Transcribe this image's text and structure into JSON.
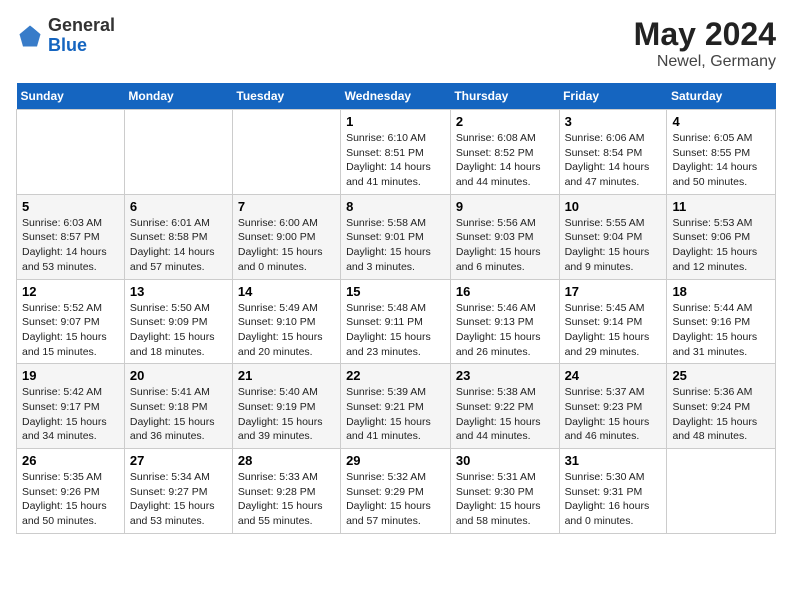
{
  "header": {
    "logo_general": "General",
    "logo_blue": "Blue",
    "month": "May 2024",
    "location": "Newel, Germany"
  },
  "weekdays": [
    "Sunday",
    "Monday",
    "Tuesday",
    "Wednesday",
    "Thursday",
    "Friday",
    "Saturday"
  ],
  "weeks": [
    [
      {
        "day": "",
        "info": ""
      },
      {
        "day": "",
        "info": ""
      },
      {
        "day": "",
        "info": ""
      },
      {
        "day": "1",
        "info": "Sunrise: 6:10 AM\nSunset: 8:51 PM\nDaylight: 14 hours\nand 41 minutes."
      },
      {
        "day": "2",
        "info": "Sunrise: 6:08 AM\nSunset: 8:52 PM\nDaylight: 14 hours\nand 44 minutes."
      },
      {
        "day": "3",
        "info": "Sunrise: 6:06 AM\nSunset: 8:54 PM\nDaylight: 14 hours\nand 47 minutes."
      },
      {
        "day": "4",
        "info": "Sunrise: 6:05 AM\nSunset: 8:55 PM\nDaylight: 14 hours\nand 50 minutes."
      }
    ],
    [
      {
        "day": "5",
        "info": "Sunrise: 6:03 AM\nSunset: 8:57 PM\nDaylight: 14 hours\nand 53 minutes."
      },
      {
        "day": "6",
        "info": "Sunrise: 6:01 AM\nSunset: 8:58 PM\nDaylight: 14 hours\nand 57 minutes."
      },
      {
        "day": "7",
        "info": "Sunrise: 6:00 AM\nSunset: 9:00 PM\nDaylight: 15 hours\nand 0 minutes."
      },
      {
        "day": "8",
        "info": "Sunrise: 5:58 AM\nSunset: 9:01 PM\nDaylight: 15 hours\nand 3 minutes."
      },
      {
        "day": "9",
        "info": "Sunrise: 5:56 AM\nSunset: 9:03 PM\nDaylight: 15 hours\nand 6 minutes."
      },
      {
        "day": "10",
        "info": "Sunrise: 5:55 AM\nSunset: 9:04 PM\nDaylight: 15 hours\nand 9 minutes."
      },
      {
        "day": "11",
        "info": "Sunrise: 5:53 AM\nSunset: 9:06 PM\nDaylight: 15 hours\nand 12 minutes."
      }
    ],
    [
      {
        "day": "12",
        "info": "Sunrise: 5:52 AM\nSunset: 9:07 PM\nDaylight: 15 hours\nand 15 minutes."
      },
      {
        "day": "13",
        "info": "Sunrise: 5:50 AM\nSunset: 9:09 PM\nDaylight: 15 hours\nand 18 minutes."
      },
      {
        "day": "14",
        "info": "Sunrise: 5:49 AM\nSunset: 9:10 PM\nDaylight: 15 hours\nand 20 minutes."
      },
      {
        "day": "15",
        "info": "Sunrise: 5:48 AM\nSunset: 9:11 PM\nDaylight: 15 hours\nand 23 minutes."
      },
      {
        "day": "16",
        "info": "Sunrise: 5:46 AM\nSunset: 9:13 PM\nDaylight: 15 hours\nand 26 minutes."
      },
      {
        "day": "17",
        "info": "Sunrise: 5:45 AM\nSunset: 9:14 PM\nDaylight: 15 hours\nand 29 minutes."
      },
      {
        "day": "18",
        "info": "Sunrise: 5:44 AM\nSunset: 9:16 PM\nDaylight: 15 hours\nand 31 minutes."
      }
    ],
    [
      {
        "day": "19",
        "info": "Sunrise: 5:42 AM\nSunset: 9:17 PM\nDaylight: 15 hours\nand 34 minutes."
      },
      {
        "day": "20",
        "info": "Sunrise: 5:41 AM\nSunset: 9:18 PM\nDaylight: 15 hours\nand 36 minutes."
      },
      {
        "day": "21",
        "info": "Sunrise: 5:40 AM\nSunset: 9:19 PM\nDaylight: 15 hours\nand 39 minutes."
      },
      {
        "day": "22",
        "info": "Sunrise: 5:39 AM\nSunset: 9:21 PM\nDaylight: 15 hours\nand 41 minutes."
      },
      {
        "day": "23",
        "info": "Sunrise: 5:38 AM\nSunset: 9:22 PM\nDaylight: 15 hours\nand 44 minutes."
      },
      {
        "day": "24",
        "info": "Sunrise: 5:37 AM\nSunset: 9:23 PM\nDaylight: 15 hours\nand 46 minutes."
      },
      {
        "day": "25",
        "info": "Sunrise: 5:36 AM\nSunset: 9:24 PM\nDaylight: 15 hours\nand 48 minutes."
      }
    ],
    [
      {
        "day": "26",
        "info": "Sunrise: 5:35 AM\nSunset: 9:26 PM\nDaylight: 15 hours\nand 50 minutes."
      },
      {
        "day": "27",
        "info": "Sunrise: 5:34 AM\nSunset: 9:27 PM\nDaylight: 15 hours\nand 53 minutes."
      },
      {
        "day": "28",
        "info": "Sunrise: 5:33 AM\nSunset: 9:28 PM\nDaylight: 15 hours\nand 55 minutes."
      },
      {
        "day": "29",
        "info": "Sunrise: 5:32 AM\nSunset: 9:29 PM\nDaylight: 15 hours\nand 57 minutes."
      },
      {
        "day": "30",
        "info": "Sunrise: 5:31 AM\nSunset: 9:30 PM\nDaylight: 15 hours\nand 58 minutes."
      },
      {
        "day": "31",
        "info": "Sunrise: 5:30 AM\nSunset: 9:31 PM\nDaylight: 16 hours\nand 0 minutes."
      },
      {
        "day": "",
        "info": ""
      }
    ]
  ]
}
